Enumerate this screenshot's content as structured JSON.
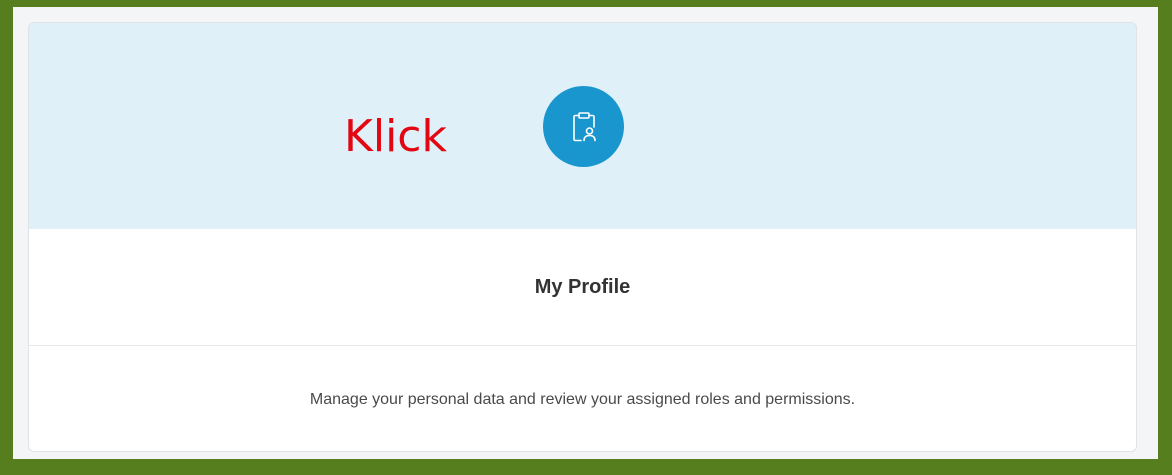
{
  "tile": {
    "title": "My Profile",
    "description": "Manage your personal data and review your assigned roles and permissions.",
    "icon": "clipboard-person-icon"
  },
  "annotation": {
    "text": "Klick"
  },
  "colors": {
    "frame": "#567d1e",
    "banner": "#dff0f8",
    "icon_circle": "#1a96cf",
    "annotation": "#e30613",
    "title_text": "#333333"
  }
}
